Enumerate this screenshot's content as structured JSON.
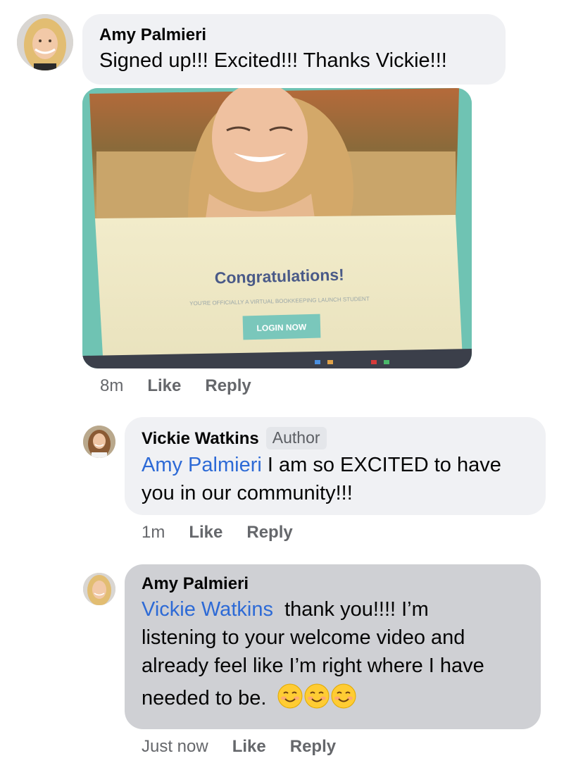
{
  "comments": [
    {
      "author": "Amy Palmieri",
      "text": "Signed up!!! Excited!!! Thanks Vickie!!!",
      "time": "8m",
      "like_label": "Like",
      "reply_label": "Reply",
      "photo": {
        "heading": "Congratulations!",
        "subtext": "YOU'RE OFFICIALLY A VIRTUAL BOOKKEEPING LAUNCH STUDENT",
        "button_label": "LOGIN NOW"
      }
    },
    {
      "author": "Vickie Watkins",
      "badge": "Author",
      "mention": "Amy Palmieri",
      "text_line1": " I am so EXCITED to have",
      "text_line2": "you in our community!!!",
      "time": "1m",
      "like_label": "Like",
      "reply_label": "Reply"
    },
    {
      "author": "Amy Palmieri",
      "mention": "Vickie Watkins",
      "text_line1": "  thank you!!!! I’m",
      "text_line2": "listening to your welcome video and",
      "text_line3": "already feel like I’m right where I have",
      "text_line4": "needed to be.",
      "emojis": [
        "smiling-face-icon",
        "smiling-face-icon",
        "smiling-face-icon"
      ],
      "time": "Just now",
      "like_label": "Like",
      "reply_label": "Reply"
    }
  ]
}
